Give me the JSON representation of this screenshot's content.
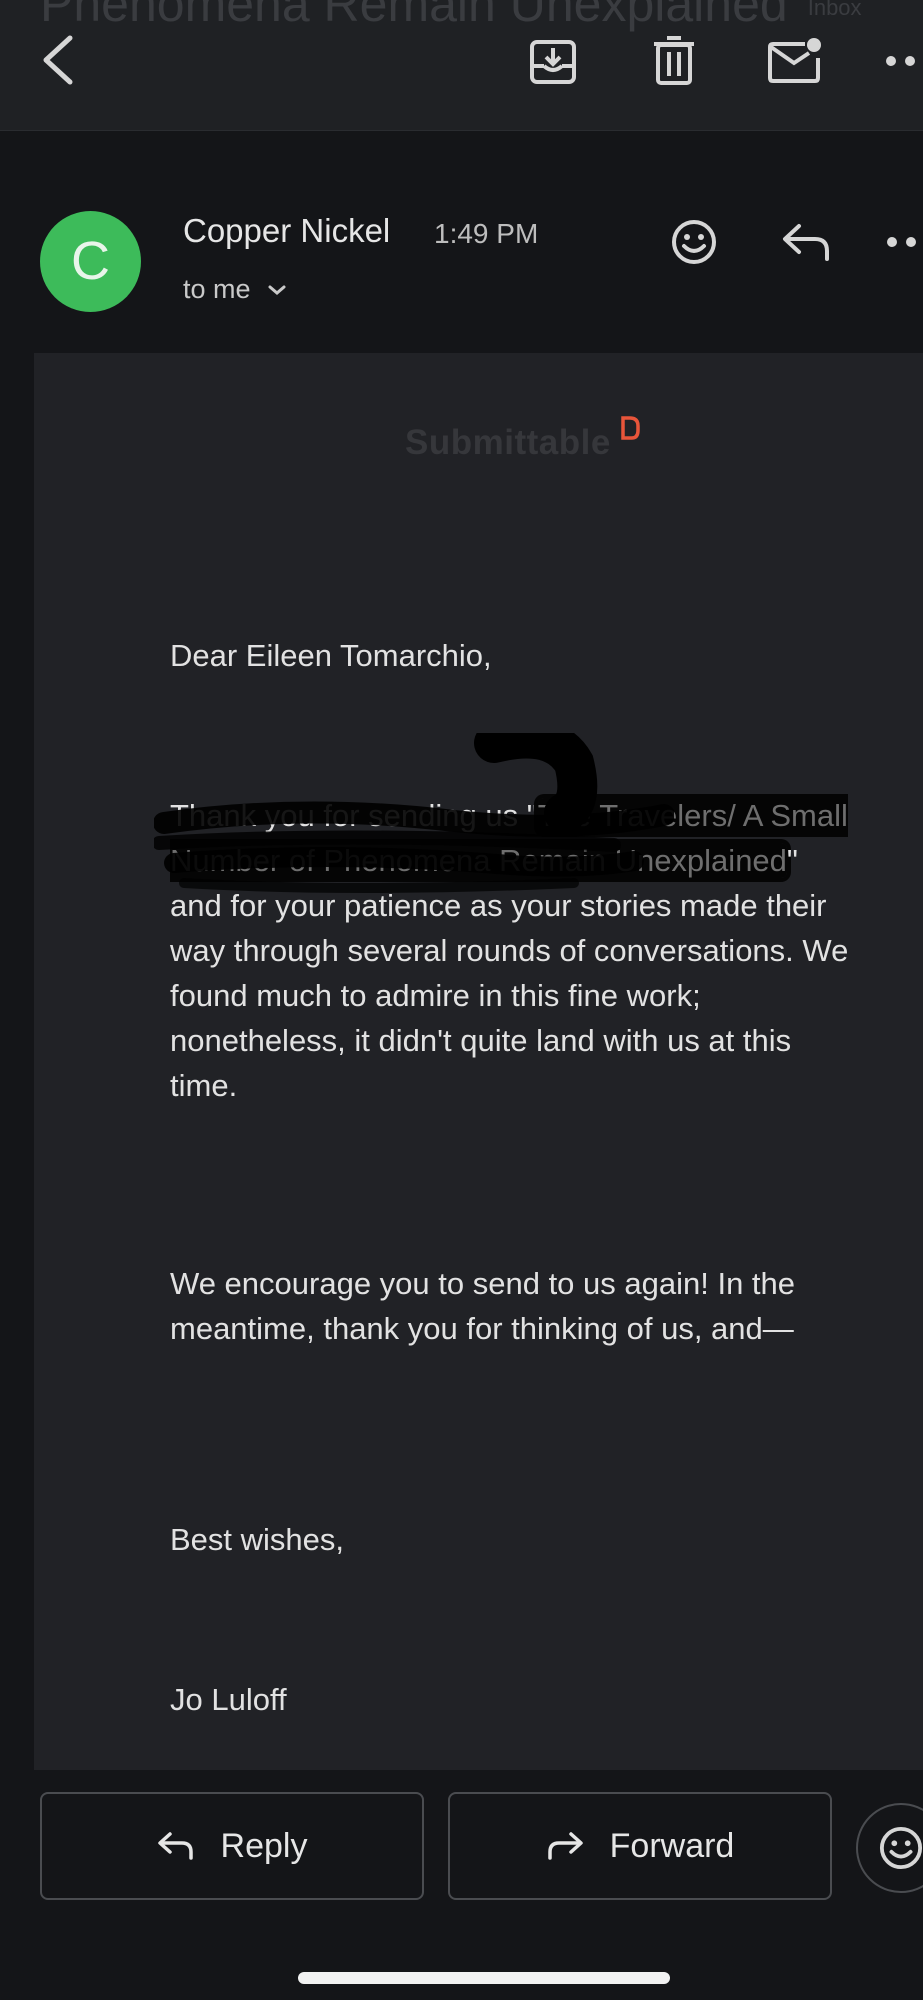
{
  "header": {
    "ghost_title": "Phenomena Remain Unexplained",
    "ghost_chip": "Inbox"
  },
  "sender": {
    "initial": "C",
    "name": "Copper Nickel",
    "time": "1:49 PM",
    "recipient": "to me",
    "avatar_color": "#3dbb5a"
  },
  "message": {
    "logo_text": "Submittable",
    "logo_color": "#e8553a",
    "greeting": "Dear Eileen Tomarchio,",
    "p1_before": "Thank you for sending us \"",
    "p1_redacted": "The Travelers/ A Small Number of Phenomena Remain Unexplained",
    "p1_after": "\" and for your patience as your stories made their way through several rounds of conversations. We found much to admire in this fine work; nonetheless, it didn't quite land with us at this time.",
    "p2": "We encourage you to send to us again! In the meantime, thank you for thinking of us, and—",
    "closing": "Best wishes,",
    "signature": "Jo Luloff"
  },
  "actions": {
    "reply_label": "Reply",
    "forward_label": "Forward"
  },
  "icons": {
    "back": "chevron-left-icon",
    "archive": "archive-icon",
    "delete": "trash-icon",
    "mark_unread": "mail-unread-icon",
    "more": "more-horizontal-icon",
    "emoji": "smiley-icon",
    "reply": "reply-arrow-icon",
    "forward": "forward-arrow-icon",
    "expand": "chevron-down-icon"
  }
}
